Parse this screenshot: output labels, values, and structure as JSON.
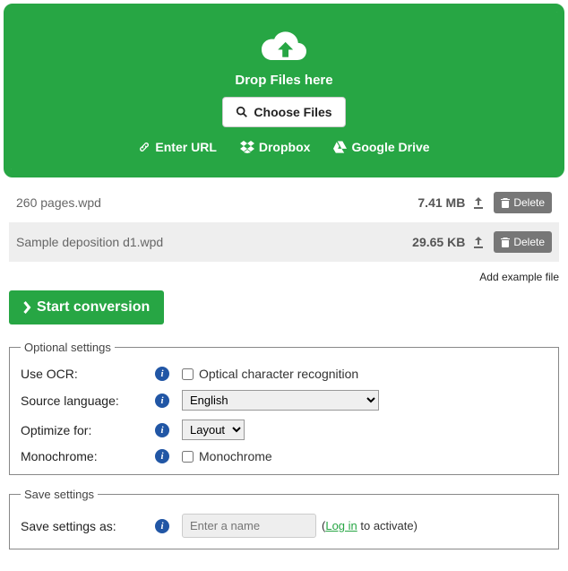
{
  "dropzone": {
    "drop_text": "Drop Files here",
    "choose_label": "Choose Files",
    "sources": {
      "url": "Enter URL",
      "dropbox": "Dropbox",
      "gdrive": "Google Drive"
    }
  },
  "files": [
    {
      "name": "260 pages.wpd",
      "size": "7.41 MB"
    },
    {
      "name": "Sample deposition d1.wpd",
      "size": "29.65 KB"
    }
  ],
  "delete_label": "Delete",
  "add_example": "Add example file",
  "start_label": "Start conversion",
  "optional_legend": "Optional settings",
  "settings": {
    "ocr": {
      "label": "Use OCR:",
      "checkbox": "Optical character recognition"
    },
    "lang": {
      "label": "Source language:",
      "selected": "English"
    },
    "optimize": {
      "label": "Optimize for:",
      "selected": "Layout"
    },
    "mono": {
      "label": "Monochrome:",
      "checkbox": "Monochrome"
    }
  },
  "save": {
    "legend": "Save settings",
    "label": "Save settings as:",
    "placeholder": "Enter a name",
    "hint_pre": "(",
    "login": "Log in",
    "hint_post": " to activate)"
  }
}
